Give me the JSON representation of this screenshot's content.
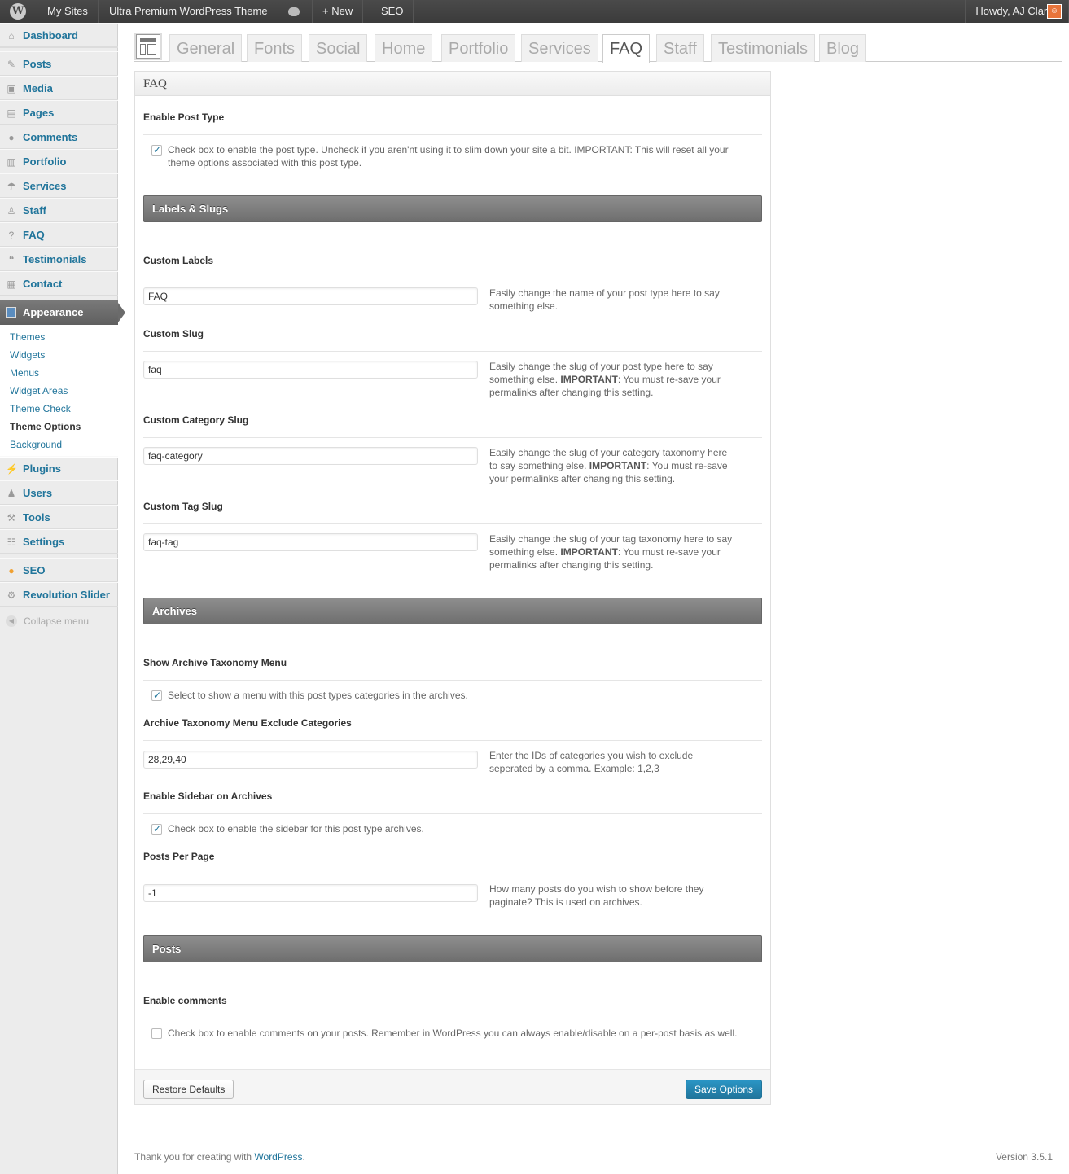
{
  "adminbar": {
    "wp_logo": "W",
    "my_sites": "My Sites",
    "site_name": "Ultra Premium WordPress Theme",
    "new_label": "New",
    "seo_label": "SEO",
    "account": "Howdy, AJ Clarke"
  },
  "sidebar": {
    "items": [
      {
        "label": "Dashboard",
        "icon": "home-icon"
      },
      {
        "label": "Posts",
        "icon": "pin-icon"
      },
      {
        "label": "Media",
        "icon": "media-icon"
      },
      {
        "label": "Pages",
        "icon": "page-icon"
      },
      {
        "label": "Comments",
        "icon": "comment-icon"
      },
      {
        "label": "Portfolio",
        "icon": "portfolio-icon"
      },
      {
        "label": "Services",
        "icon": "umbrella-icon"
      },
      {
        "label": "Staff",
        "icon": "person-icon"
      },
      {
        "label": "FAQ",
        "icon": "question-icon"
      },
      {
        "label": "Testimonials",
        "icon": "quote-icon"
      },
      {
        "label": "Contact",
        "icon": "contact-icon"
      }
    ],
    "appearance": "Appearance",
    "submenu": [
      "Themes",
      "Widgets",
      "Menus",
      "Widget Areas",
      "Theme Check",
      "Theme Options",
      "Background"
    ],
    "lower_items": [
      {
        "label": "Plugins",
        "icon": "plug-icon"
      },
      {
        "label": "Users",
        "icon": "users-icon"
      },
      {
        "label": "Tools",
        "icon": "tools-icon"
      },
      {
        "label": "Settings",
        "icon": "settings-icon"
      }
    ],
    "extra_items": [
      {
        "label": "SEO",
        "icon": "seo-icon"
      },
      {
        "label": "Revolution Slider",
        "icon": "gear-icon"
      }
    ],
    "collapse": "Collapse menu"
  },
  "tabs": [
    "General",
    "Fonts",
    "Social",
    "Home",
    "Portfolio",
    "Services",
    "FAQ",
    "Staff",
    "Testimonials",
    "Blog"
  ],
  "active_tab": "FAQ",
  "panel": {
    "title": "FAQ",
    "enable_post_type": {
      "title": "Enable Post Type",
      "checked": true,
      "text": "Check box to enable the post type. Uncheck if you aren'nt using it to slim down your site a bit. IMPORTANT: This will reset all your theme options associated with this post type."
    },
    "labels_section": "Labels & Slugs",
    "custom_labels": {
      "title": "Custom Labels",
      "value": "FAQ",
      "desc": "Easily change the name of your post type here to say something else."
    },
    "custom_slug": {
      "title": "Custom Slug",
      "value": "faq",
      "desc_a": "Easily change the slug of your post type here to say something else. ",
      "desc_b": "IMPORTANT",
      "desc_c": ": You must re-save your permalinks after changing this setting."
    },
    "custom_category_slug": {
      "title": "Custom Category Slug",
      "value": "faq-category",
      "desc_a": "Easily change the slug of your category taxonomy here to say something else. ",
      "desc_b": "IMPORTANT",
      "desc_c": ": You must re-save your permalinks after changing this setting."
    },
    "custom_tag_slug": {
      "title": "Custom Tag Slug",
      "value": "faq-tag",
      "desc_a": "Easily change the slug of your tag taxonomy here to say something else. ",
      "desc_b": "IMPORTANT",
      "desc_c": ": You must re-save your permalinks after changing this setting."
    },
    "archives_section": "Archives",
    "show_archive_menu": {
      "title": "Show Archive Taxonomy Menu",
      "checked": true,
      "text": "Select to show a menu with this post types categories in the archives."
    },
    "exclude_categories": {
      "title": "Archive Taxonomy Menu Exclude Categories",
      "value": "28,29,40",
      "desc": "Enter the IDs of categories you wish to exclude seperated by a comma. Example: 1,2,3"
    },
    "enable_sidebar": {
      "title": "Enable Sidebar on Archives",
      "checked": true,
      "text": "Check box to enable the sidebar for this post type archives."
    },
    "posts_per_page": {
      "title": "Posts Per Page",
      "value": "-1",
      "desc": "How many posts do you wish to show before they paginate? This is used on archives."
    },
    "posts_section": "Posts",
    "enable_comments": {
      "title": "Enable comments",
      "checked": false,
      "text": "Check box to enable comments on your posts. Remember in WordPress you can always enable/disable on a per-post basis as well."
    },
    "restore_label": "Restore Defaults",
    "save_label": "Save Options"
  },
  "footer": {
    "thanks": "Thank you for creating with ",
    "link": "WordPress",
    "period": ".",
    "version": "Version 3.5.1"
  },
  "colors": {
    "link": "#21759b",
    "primary_button": "#2a95c5",
    "section_bar": "#7a7a7a"
  }
}
